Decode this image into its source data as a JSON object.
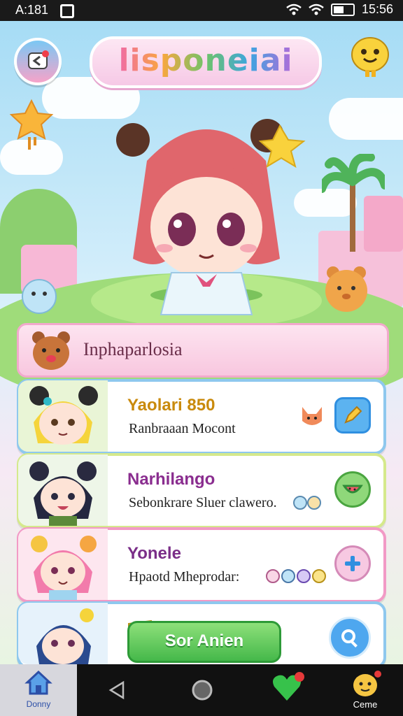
{
  "status_bar": {
    "time": "A:181",
    "right_time": "15:56"
  },
  "header": {
    "title": "lisponeiai"
  },
  "list": {
    "header_label": "Inphaparlosia",
    "items": [
      {
        "name": "Yaolari 850",
        "subtitle": "Ranbraaan Mocont",
        "name_color": "#c98a0c",
        "border": "#8ec8ee"
      },
      {
        "name": "Narhilango",
        "subtitle": "Sebonkrare Sluer clawero.",
        "name_color": "#8a2d8f",
        "border": "#d5e98c"
      },
      {
        "name": "Yonele",
        "subtitle": "Hpaotd Mheprodar:",
        "name_color": "#7a2e88",
        "border": "#f29ac6"
      }
    ],
    "cta_label": "Sor Anien"
  },
  "nav": {
    "home_label": "Donny",
    "game_label": "Ceme"
  },
  "colors": {
    "accent": "#f06aa6",
    "green": "#45b84a",
    "blue": "#2f8fe0"
  }
}
